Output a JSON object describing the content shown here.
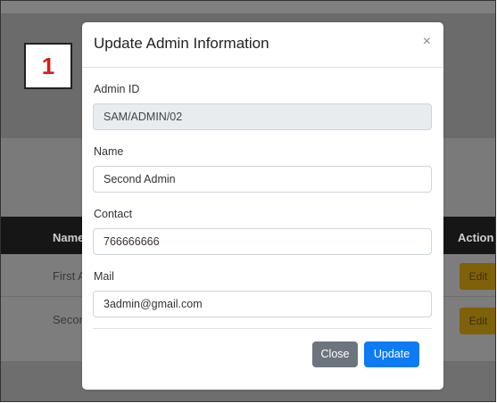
{
  "background": {
    "table_headers": {
      "name": "Name",
      "action": "Action"
    },
    "rows": [
      {
        "name": "First A",
        "action": "Edit"
      },
      {
        "name": "Secon",
        "action": "Edit"
      }
    ]
  },
  "step_badge": "1",
  "modal": {
    "title": "Update Admin Information",
    "close_icon": "×",
    "fields": {
      "admin_id": {
        "label": "Admin ID",
        "value": "SAM/ADMIN/02"
      },
      "name": {
        "label": "Name",
        "value": "Second Admin"
      },
      "contact": {
        "label": "Contact",
        "value": "766666666"
      },
      "mail": {
        "label": "Mail",
        "value": "3admin@gmail.com"
      }
    },
    "buttons": {
      "close": "Close",
      "update": "Update"
    }
  },
  "colors": {
    "primary": "#0d7bf3",
    "secondary": "#6c757d",
    "edit": "#7e6109",
    "badge_text": "#d91c1c"
  }
}
